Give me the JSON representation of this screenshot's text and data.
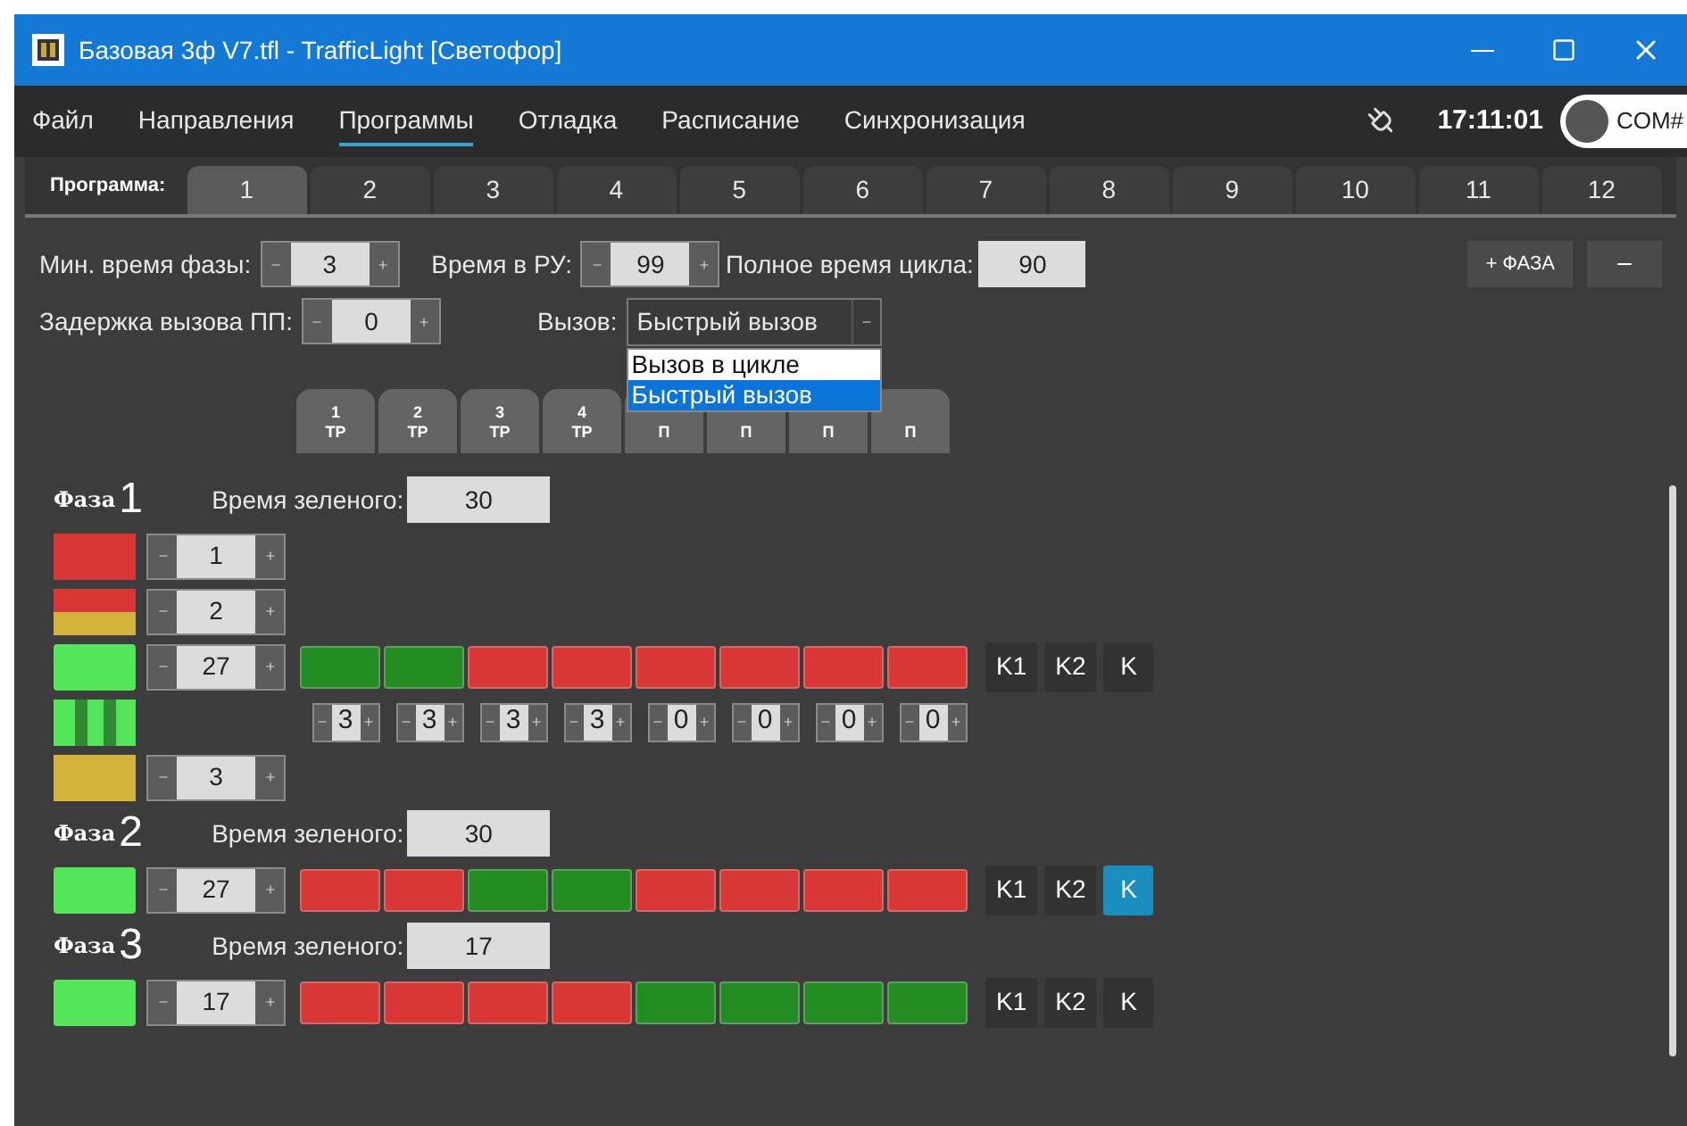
{
  "window": {
    "title": "Базовая 3ф V7.tfl - TrafficLight [Светофор]"
  },
  "menu": [
    {
      "label": "Файл",
      "selected": false
    },
    {
      "label": "Направления",
      "selected": false
    },
    {
      "label": "Программы",
      "selected": true
    },
    {
      "label": "Отладка",
      "selected": false
    },
    {
      "label": "Расписание",
      "selected": false
    },
    {
      "label": "Синхронизация",
      "selected": false
    }
  ],
  "status": {
    "time": "17:11:01",
    "port": {
      "label": "COM#",
      "on": false
    }
  },
  "program_tabs": {
    "label": "Программа:",
    "tabs": [
      {
        "label": "1",
        "selected": true
      },
      {
        "label": "2",
        "selected": false
      },
      {
        "label": "3",
        "selected": false
      },
      {
        "label": "4",
        "selected": false
      },
      {
        "label": "5",
        "selected": false
      },
      {
        "label": "6",
        "selected": false
      },
      {
        "label": "7",
        "selected": false
      },
      {
        "label": "8",
        "selected": false
      },
      {
        "label": "9",
        "selected": false
      },
      {
        "label": "10",
        "selected": false
      },
      {
        "label": "11",
        "selected": false
      },
      {
        "label": "12",
        "selected": false
      }
    ]
  },
  "settings": {
    "min_phase_time": {
      "label": "Мин. время фазы:",
      "value": "3"
    },
    "manual_time": {
      "label": "Время в РУ:",
      "value": "99"
    },
    "cycle_time": {
      "label": "Полное время цикла:",
      "value": "90"
    },
    "call_delay": {
      "label": "Задержка вызова ПП:",
      "value": "0"
    },
    "call": {
      "label": "Вызов:",
      "value": "Быстрый вызов",
      "expanded": true,
      "options": [
        {
          "label": "Вызов в цикле",
          "selected": false
        },
        {
          "label": "Быстрый вызов",
          "selected": true
        }
      ]
    }
  },
  "phase_buttons": [
    "+ ФАЗА"
  ],
  "directions": [
    {
      "number": "1",
      "type": "ТР"
    },
    {
      "number": "2",
      "type": "ТР"
    },
    {
      "number": "3",
      "type": "ТР"
    },
    {
      "number": "4",
      "type": "ТР"
    },
    {
      "type": "П"
    },
    {
      "type": "П"
    },
    {
      "type": "П"
    },
    {
      "type": "П"
    }
  ],
  "phases": [
    {
      "label": "Фаза",
      "number": "1",
      "green_label": "Время зеленого:",
      "green_time": "30",
      "rows": [
        {
          "kind": "red",
          "value": "1"
        },
        {
          "kind": "redyellow",
          "value": "2"
        },
        {
          "kind": "green",
          "value": "27",
          "cells": [
            {
              "color": "#228b22"
            },
            {
              "color": "#228b22"
            },
            {
              "color": "#d93636"
            },
            {
              "color": "#d93636"
            },
            {
              "color": "#d93636"
            },
            {
              "color": "#d93636"
            },
            {
              "color": "#d93636"
            },
            {
              "color": "#d93636"
            }
          ],
          "keys": [
            {
              "label": "K1",
              "selected": false
            },
            {
              "label": "K2",
              "selected": false
            },
            {
              "label": "K",
              "selected": false
            }
          ]
        },
        {
          "kind": "blink",
          "values": [
            "3",
            "3",
            "3",
            "3",
            "0",
            "0",
            "0",
            "0"
          ]
        },
        {
          "kind": "yellow",
          "value": "3"
        }
      ]
    },
    {
      "label": "Фаза",
      "number": "2",
      "green_label": "Время зеленого:",
      "green_time": "30",
      "rows": [
        {
          "kind": "green",
          "value": "27",
          "cells": [
            {
              "color": "#d93636"
            },
            {
              "color": "#d93636"
            },
            {
              "color": "#228b22"
            },
            {
              "color": "#228b22"
            },
            {
              "color": "#d93636"
            },
            {
              "color": "#d93636"
            },
            {
              "color": "#d93636"
            },
            {
              "color": "#d93636"
            }
          ],
          "keys": [
            {
              "label": "K1",
              "selected": false
            },
            {
              "label": "K2",
              "selected": false
            },
            {
              "label": "K",
              "selected": true
            }
          ]
        }
      ]
    },
    {
      "label": "Фаза",
      "number": "3",
      "green_label": "Время зеленого:",
      "green_time": "17",
      "rows": [
        {
          "kind": "green",
          "value": "17",
          "cells": [
            {
              "color": "#d93636"
            },
            {
              "color": "#d93636"
            },
            {
              "color": "#d93636"
            },
            {
              "color": "#d93636"
            },
            {
              "color": "#228b22"
            },
            {
              "color": "#228b22"
            },
            {
              "color": "#228b22"
            },
            {
              "color": "#228b22"
            }
          ],
          "keys": [
            {
              "label": "K1",
              "selected": false
            },
            {
              "label": "K2",
              "selected": false
            },
            {
              "label": "K",
              "selected": false
            }
          ]
        }
      ]
    }
  ]
}
